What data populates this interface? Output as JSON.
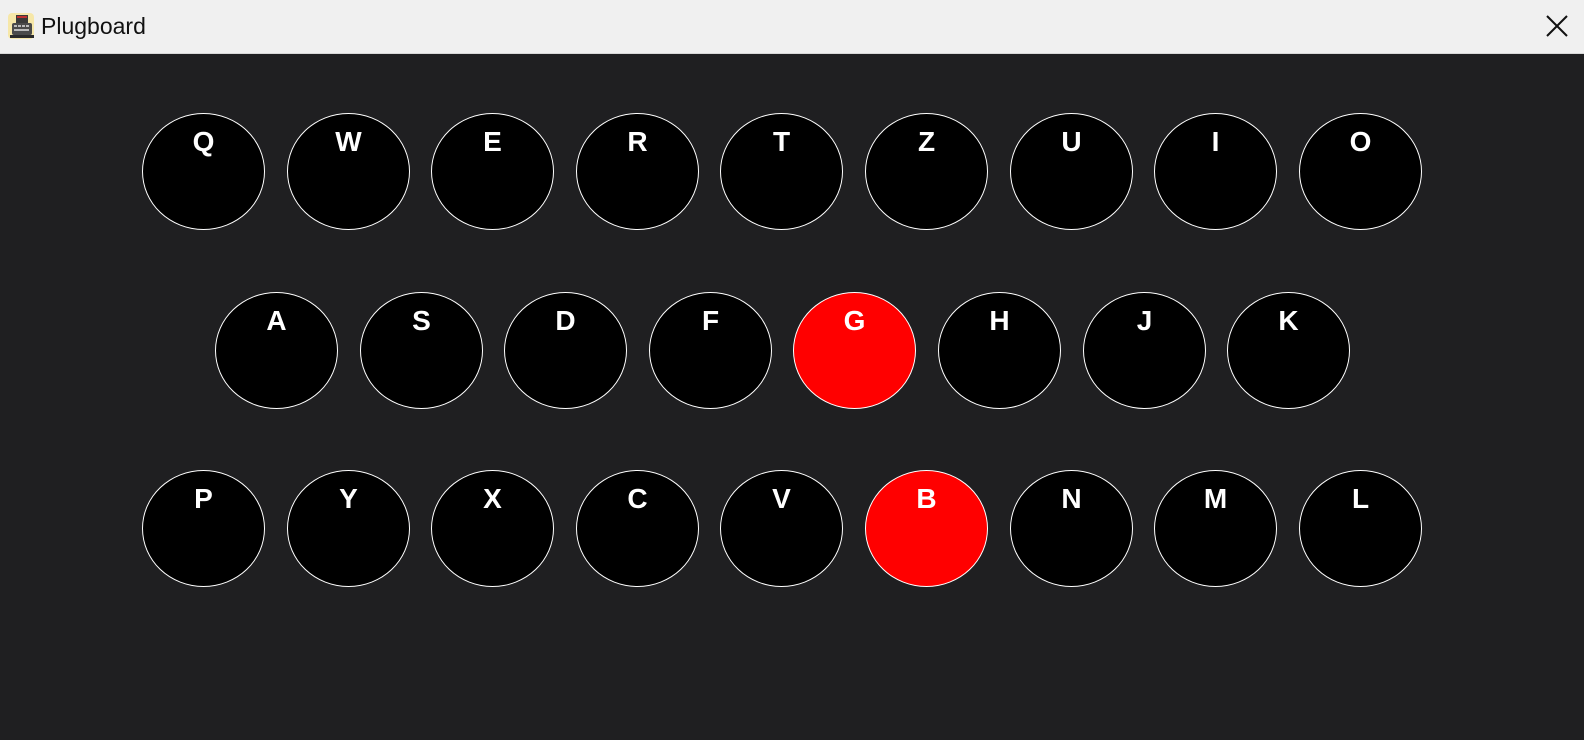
{
  "window": {
    "title": "Plugboard",
    "icon": "typewriter-icon",
    "close_icon": "close-icon"
  },
  "colors": {
    "background": "#1f1f21",
    "plug_fill": "#000000",
    "plug_border": "#ffffff",
    "plug_active": "#ff0000",
    "label": "#ffffff"
  },
  "rows": [
    {
      "keys": [
        {
          "letter": "Q",
          "active": false
        },
        {
          "letter": "W",
          "active": false
        },
        {
          "letter": "E",
          "active": false
        },
        {
          "letter": "R",
          "active": false
        },
        {
          "letter": "T",
          "active": false
        },
        {
          "letter": "Z",
          "active": false
        },
        {
          "letter": "U",
          "active": false
        },
        {
          "letter": "I",
          "active": false
        },
        {
          "letter": "O",
          "active": false
        }
      ]
    },
    {
      "keys": [
        {
          "letter": "A",
          "active": false
        },
        {
          "letter": "S",
          "active": false
        },
        {
          "letter": "D",
          "active": false
        },
        {
          "letter": "F",
          "active": false
        },
        {
          "letter": "G",
          "active": true
        },
        {
          "letter": "H",
          "active": false
        },
        {
          "letter": "J",
          "active": false
        },
        {
          "letter": "K",
          "active": false
        }
      ]
    },
    {
      "keys": [
        {
          "letter": "P",
          "active": false
        },
        {
          "letter": "Y",
          "active": false
        },
        {
          "letter": "X",
          "active": false
        },
        {
          "letter": "C",
          "active": false
        },
        {
          "letter": "V",
          "active": false
        },
        {
          "letter": "B",
          "active": true
        },
        {
          "letter": "N",
          "active": false
        },
        {
          "letter": "M",
          "active": false
        },
        {
          "letter": "L",
          "active": false
        }
      ]
    }
  ]
}
